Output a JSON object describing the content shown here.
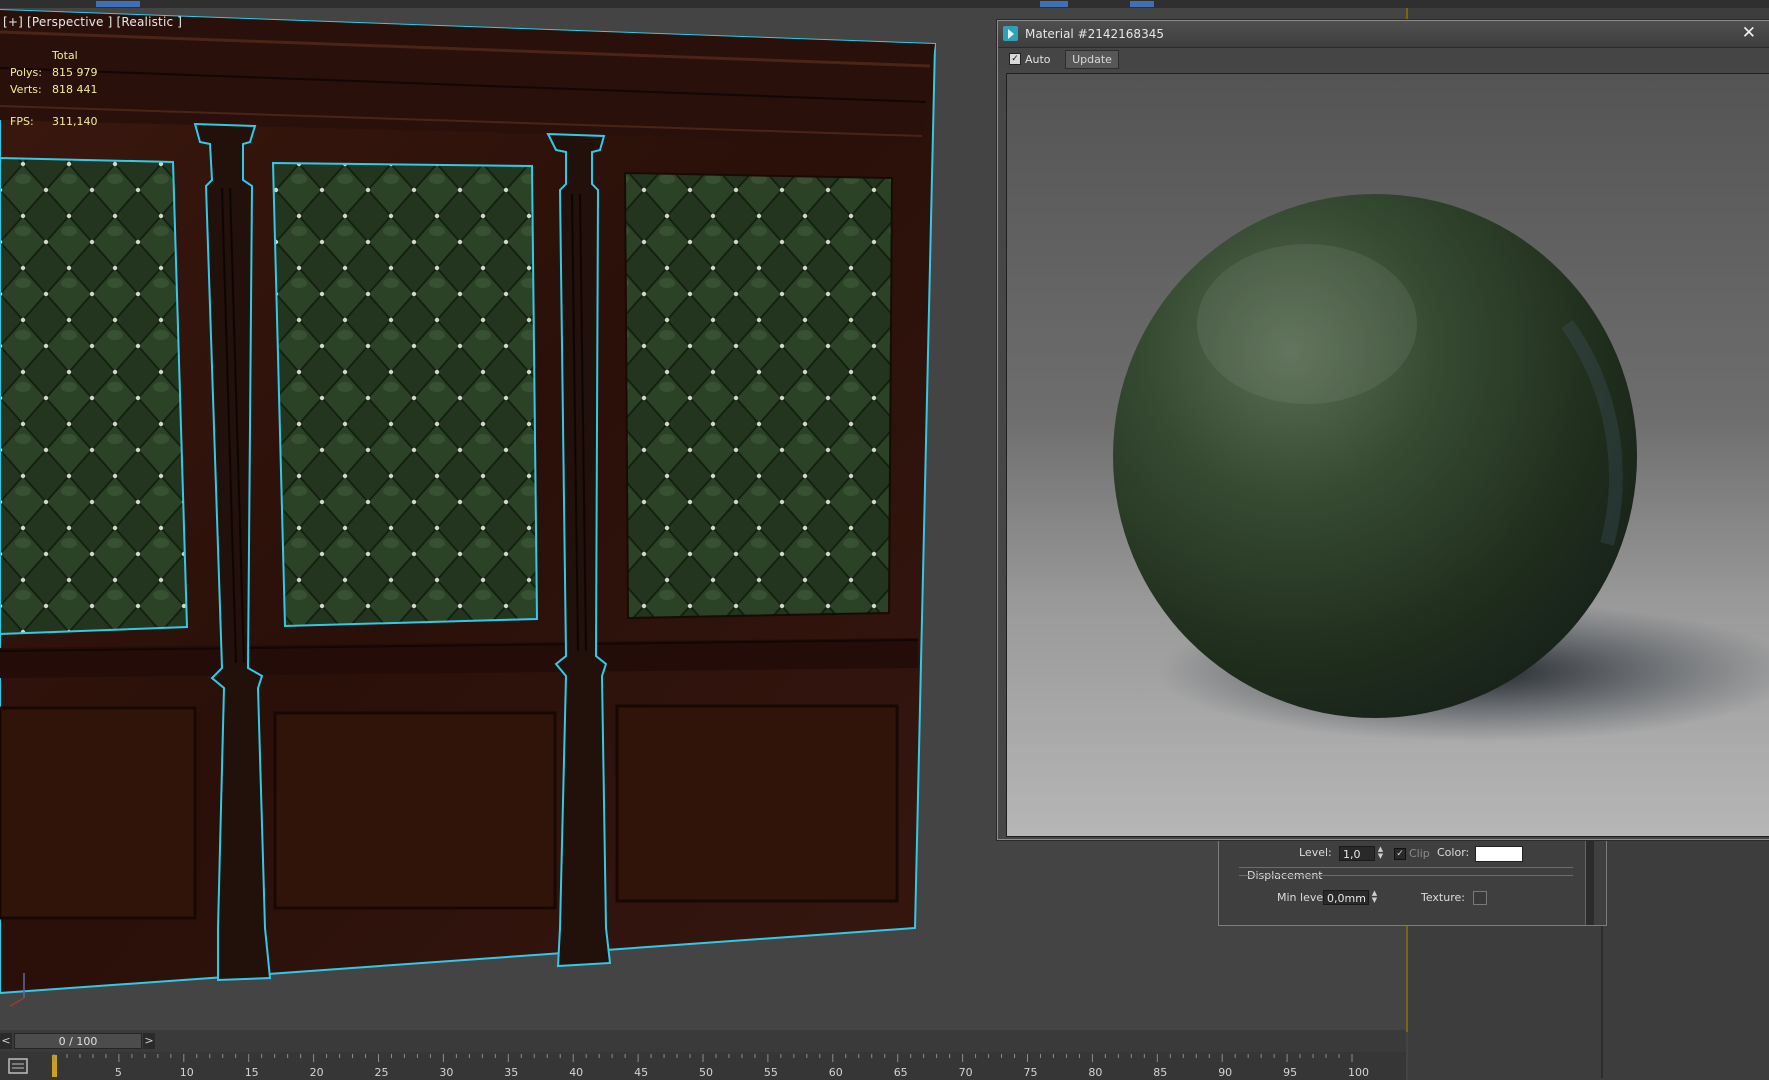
{
  "viewport": {
    "label": "[+] [Perspective ] [Realistic ]",
    "stats": {
      "header": "Total",
      "rows": [
        {
          "key": "Polys:",
          "value": "815 979"
        },
        {
          "key": "Verts:",
          "value": "818 441"
        }
      ],
      "fps_key": "FPS:",
      "fps_value": "311,140"
    }
  },
  "material_editor": {
    "title": "Material #2142168345",
    "close_glyph": "✕",
    "auto_label": "Auto",
    "auto_checked": true,
    "update_label": "Update"
  },
  "settings_panel": {
    "level_label": "Level:",
    "level_value": "1,0",
    "clip_label": "Clip",
    "clip_checked": true,
    "color_label": "Color:",
    "displacement_label": "Displacement",
    "min_level_label": "Min level:",
    "min_level_value": "0,0mm",
    "texture_label": "Texture:"
  },
  "timeline": {
    "frame_readout": "0 / 100",
    "left_arrow": "<",
    "right_arrow": ">",
    "ticks": [
      "5",
      "10",
      "15",
      "20",
      "25",
      "30",
      "35",
      "40",
      "45",
      "50",
      "55",
      "60",
      "65",
      "70",
      "75",
      "80",
      "85",
      "90",
      "95",
      "100"
    ]
  },
  "colors": {
    "selection_outline": "#33c9e6",
    "leather_green": "#23351f",
    "wood_dark": "#2e130c",
    "stats_text": "#f0ee9a",
    "viewport_border": "#7a6418"
  }
}
